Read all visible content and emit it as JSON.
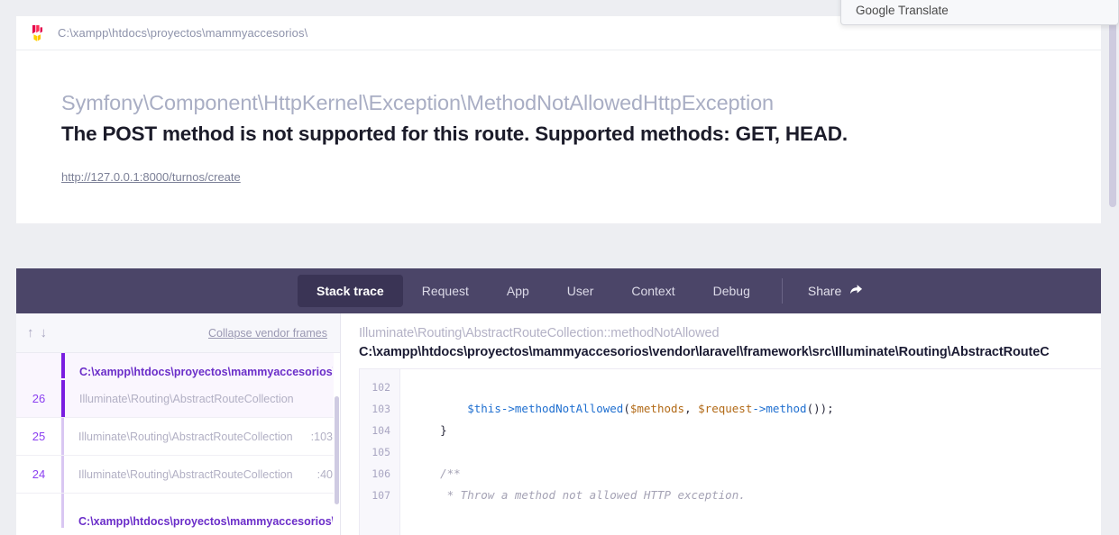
{
  "browser": {
    "translate_popup": {
      "label": "Google Translate"
    },
    "scrollbar": {
      "name": "page-scrollbar"
    }
  },
  "exception": {
    "app_path": "C:\\xampp\\htdocs\\proyectos\\mammyaccesorios\\",
    "logo_name": "flare-logo",
    "class": "Symfony\\Component\\HttpKernel\\Exception\\MethodNotAllowedHttpException",
    "message": "The POST method is not supported for this route. Supported methods: GET, HEAD.",
    "url": "http://127.0.0.1:8000/turnos/create"
  },
  "tabs": {
    "items": [
      {
        "label": "Stack trace",
        "active": true
      },
      {
        "label": "Request",
        "active": false
      },
      {
        "label": "App",
        "active": false
      },
      {
        "label": "User",
        "active": false
      },
      {
        "label": "Context",
        "active": false
      },
      {
        "label": "Debug",
        "active": false
      }
    ],
    "share": {
      "label": "Share",
      "icon": "share-arrow-icon"
    }
  },
  "frames_panel": {
    "nav": {
      "up_icon": "arrow-up-icon",
      "up_glyph": "↑",
      "down_icon": "arrow-down-icon",
      "down_glyph": "↓"
    },
    "collapse_link": "Collapse vendor frames",
    "groups": [
      {
        "file": "C:\\xampp\\htdocs\\proyectos\\mammyaccesorios\\vend",
        "active": true,
        "frames": [
          {
            "num": "26",
            "class": "Illuminate\\Routing\\AbstractRouteCollection",
            "line": "",
            "active": true
          },
          {
            "num": "25",
            "class": "Illuminate\\Routing\\AbstractRouteCollection",
            "line": ":103",
            "active": false
          },
          {
            "num": "24",
            "class": "Illuminate\\Routing\\AbstractRouteCollection",
            "line": ":40",
            "active": false
          }
        ]
      },
      {
        "file": "C:\\xampp\\htdocs\\proyectos\\mammyaccesorios\\vend",
        "active": false,
        "frames": []
      }
    ]
  },
  "code_panel": {
    "method": "Illuminate\\Routing\\AbstractRouteCollection::methodNotAllowed",
    "filepath": "C:\\xampp\\htdocs\\proyectos\\mammyaccesorios\\vendor\\laravel\\framework\\src\\Illuminate\\Routing\\AbstractRouteC",
    "lines": [
      {
        "num": "102",
        "text": ""
      },
      {
        "num": "103",
        "text": "        $this->methodNotAllowed($methods, $request->method());"
      },
      {
        "num": "104",
        "text": "    }"
      },
      {
        "num": "105",
        "text": ""
      },
      {
        "num": "106",
        "text": "    /**"
      },
      {
        "num": "107",
        "text": "     * Throw a method not allowed HTTP exception."
      }
    ]
  },
  "colors": {
    "header_purple": "#4b4568",
    "active_tab": "#3a3455",
    "accent_purple": "#7a1ee0",
    "frame_link": "#6b2ec9",
    "page_bg": "#edeef2"
  }
}
